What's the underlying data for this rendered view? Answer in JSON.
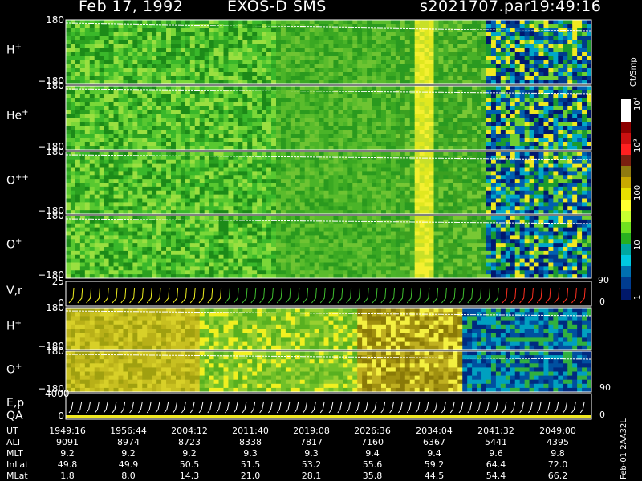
{
  "header": {
    "date": "Feb 17, 1992",
    "instrument": "EXOS-D SMS",
    "filename": "s2021707.par",
    "time": "19:49:16"
  },
  "colorbar": {
    "unit_label": "Ct/Smp",
    "ticks": [
      "10⁴",
      "10³",
      "100",
      "10",
      "1"
    ],
    "colors": [
      "#ffffff",
      "#ffffff",
      "#8b0000",
      "#cc1010",
      "#ff2020",
      "#7a1f10",
      "#8f7a10",
      "#c8a800",
      "#e8e000",
      "#ffff30",
      "#c8ff30",
      "#70e020",
      "#28b020",
      "#00a8a0",
      "#00c8e0",
      "#0070b0",
      "#003c90",
      "#00186a"
    ]
  },
  "panels": [
    {
      "id": "h-plus",
      "label": "H",
      "sup": "+",
      "ymax": "180",
      "ymin": "−180"
    },
    {
      "id": "he-plus",
      "label": "He",
      "sup": "+",
      "ymax": "180",
      "ymin": "−180"
    },
    {
      "id": "o-plusplus",
      "label": "O",
      "sup": "++",
      "ymax": "180",
      "ymin": "−180"
    },
    {
      "id": "o-plus",
      "label": "O",
      "sup": "+",
      "ymax": "180",
      "ymin": "−180"
    },
    {
      "id": "vr",
      "label": "V,r",
      "sup": "",
      "ymax": "25",
      "ymin": "0",
      "right_top": "90",
      "right_bottom": "0"
    },
    {
      "id": "h-plus-2",
      "label": "H",
      "sup": "+",
      "ymax": "180",
      "ymin": "−180"
    },
    {
      "id": "o-plus-2",
      "label": "O",
      "sup": "+",
      "ymax": "180",
      "ymin": "−180",
      "right_bottom": "90"
    },
    {
      "id": "ep-qa",
      "label": "E,p",
      "label2": "QA",
      "sup": "",
      "ymax": "4000",
      "ymin": "0",
      "right_bottom": "0"
    }
  ],
  "footer": {
    "rows": [
      {
        "name": "UT",
        "values": [
          "1949:16",
          "1956:44",
          "2004:12",
          "2011:40",
          "2019:08",
          "2026:36",
          "2034:04",
          "2041:32",
          "2049:00"
        ]
      },
      {
        "name": "ALT",
        "values": [
          "9091",
          "8974",
          "8723",
          "8338",
          "7817",
          "7160",
          "6367",
          "5441",
          "4395"
        ]
      },
      {
        "name": "MLT",
        "values": [
          "9.2",
          "9.2",
          "9.2",
          "9.3",
          "9.3",
          "9.4",
          "9.4",
          "9.6",
          "9.8"
        ]
      },
      {
        "name": "InLat",
        "values": [
          "49.8",
          "49.9",
          "50.5",
          "51.5",
          "53.2",
          "55.6",
          "59.2",
          "64.4",
          "72.0"
        ]
      },
      {
        "name": "MLat",
        "values": [
          "1.8",
          "8.0",
          "14.3",
          "21.0",
          "28.1",
          "35.8",
          "44.5",
          "54.4",
          "66.2"
        ]
      }
    ],
    "side_label": "Feb-01 2AA32L"
  },
  "chart_data": {
    "type": "heatmap",
    "title": "Feb 17, 1992   EXOS-D SMS",
    "xlabel": "UT",
    "x_ticks": [
      "1949:16",
      "1956:44",
      "2004:12",
      "2011:40",
      "2019:08",
      "2026:36",
      "2034:04",
      "2041:32",
      "2049:00"
    ],
    "colorbar_label": "Ct/Smp",
    "colorbar_ticks": [
      "1",
      "10",
      "100",
      "10³",
      "10⁴"
    ],
    "colorbar_scale": "log",
    "series": [
      {
        "name": "H+",
        "ylim": [
          -180,
          180
        ]
      },
      {
        "name": "He+",
        "ylim": [
          -180,
          180
        ]
      },
      {
        "name": "O++",
        "ylim": [
          -180,
          180
        ]
      },
      {
        "name": "O+",
        "ylim": [
          -180,
          180
        ]
      },
      {
        "name": "V,r",
        "ylim": [
          0,
          25
        ]
      },
      {
        "name": "H+",
        "ylim": [
          -180,
          180
        ]
      },
      {
        "name": "O+",
        "ylim": [
          -180,
          180
        ]
      },
      {
        "name": "E,p QA",
        "ylim": [
          0,
          4000
        ]
      }
    ]
  }
}
